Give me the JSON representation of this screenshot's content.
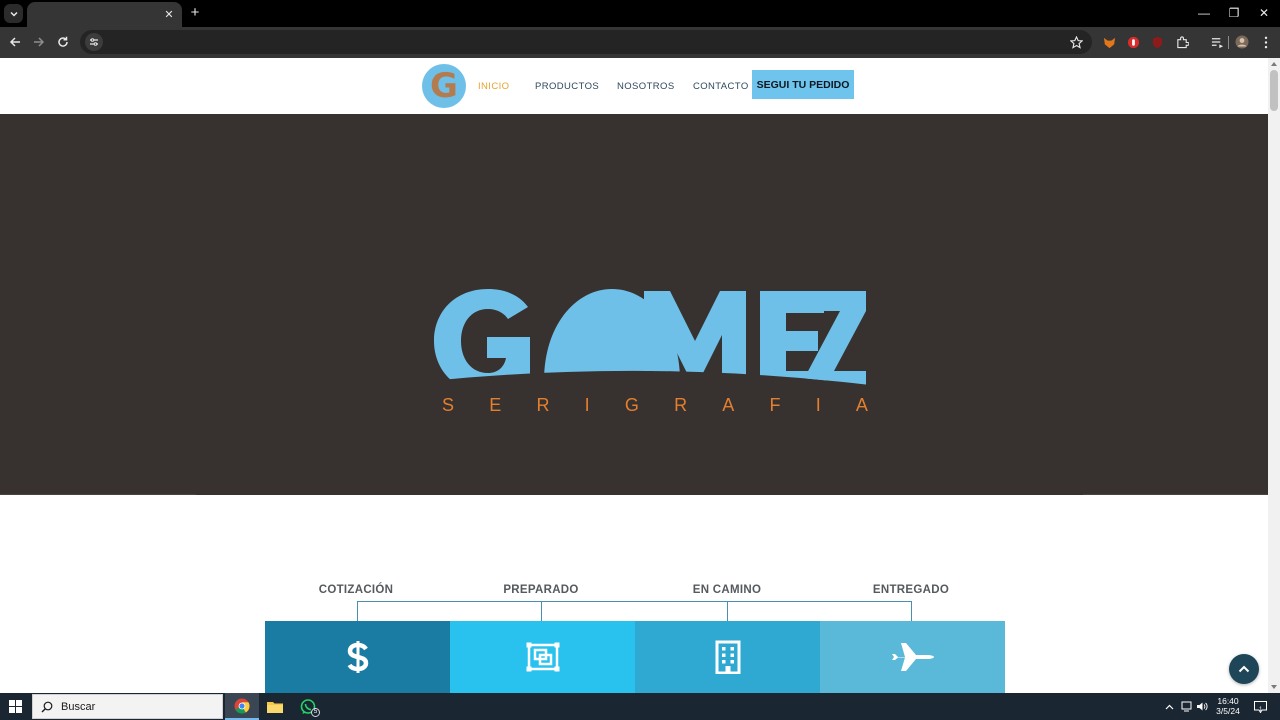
{
  "browser": {
    "tab_title": "",
    "close_tab_glyph": "✕",
    "new_tab_glyph": "+",
    "window_controls": {
      "minimize": "—",
      "restore": "❐",
      "close": "✕"
    },
    "address_bar_value": ""
  },
  "site": {
    "logo_letter": "G",
    "nav": {
      "items": [
        {
          "label": "INICIO",
          "active": true
        },
        {
          "label": "PRODUCTOS",
          "active": false
        },
        {
          "label": "NOSOTROS",
          "active": false
        },
        {
          "label": "CONTACTO",
          "active": false
        }
      ],
      "cta_label": "SEGUI TU PEDIDO"
    },
    "hero": {
      "brand_name": "GOMEZ",
      "tagline_letters": [
        "S",
        "E",
        "R",
        "I",
        "G",
        "R",
        "A",
        "F",
        "I",
        "A"
      ],
      "brand_color": "#6fc0e8",
      "tagline_color": "#e37f2e",
      "background": "#373230"
    },
    "order_status": {
      "steps": [
        {
          "label": "COTIZACIÓN",
          "icon": "dollar-icon",
          "color": "#1b7ca3"
        },
        {
          "label": "PREPARADO",
          "icon": "frame-select-icon",
          "color": "#29c2ef"
        },
        {
          "label": "EN CAMINO",
          "icon": "building-icon",
          "color": "#2fa9d1"
        },
        {
          "label": "ENTREGADO",
          "icon": "jet-plane-icon",
          "color": "#5ab8d9"
        }
      ]
    },
    "back_to_top_icon": "chevron-up-icon"
  },
  "taskbar": {
    "search_placeholder": "Buscar",
    "whatsapp_badge": "5",
    "clock_time": "16:40",
    "clock_date": "3/5/24",
    "notification_count": "1"
  }
}
